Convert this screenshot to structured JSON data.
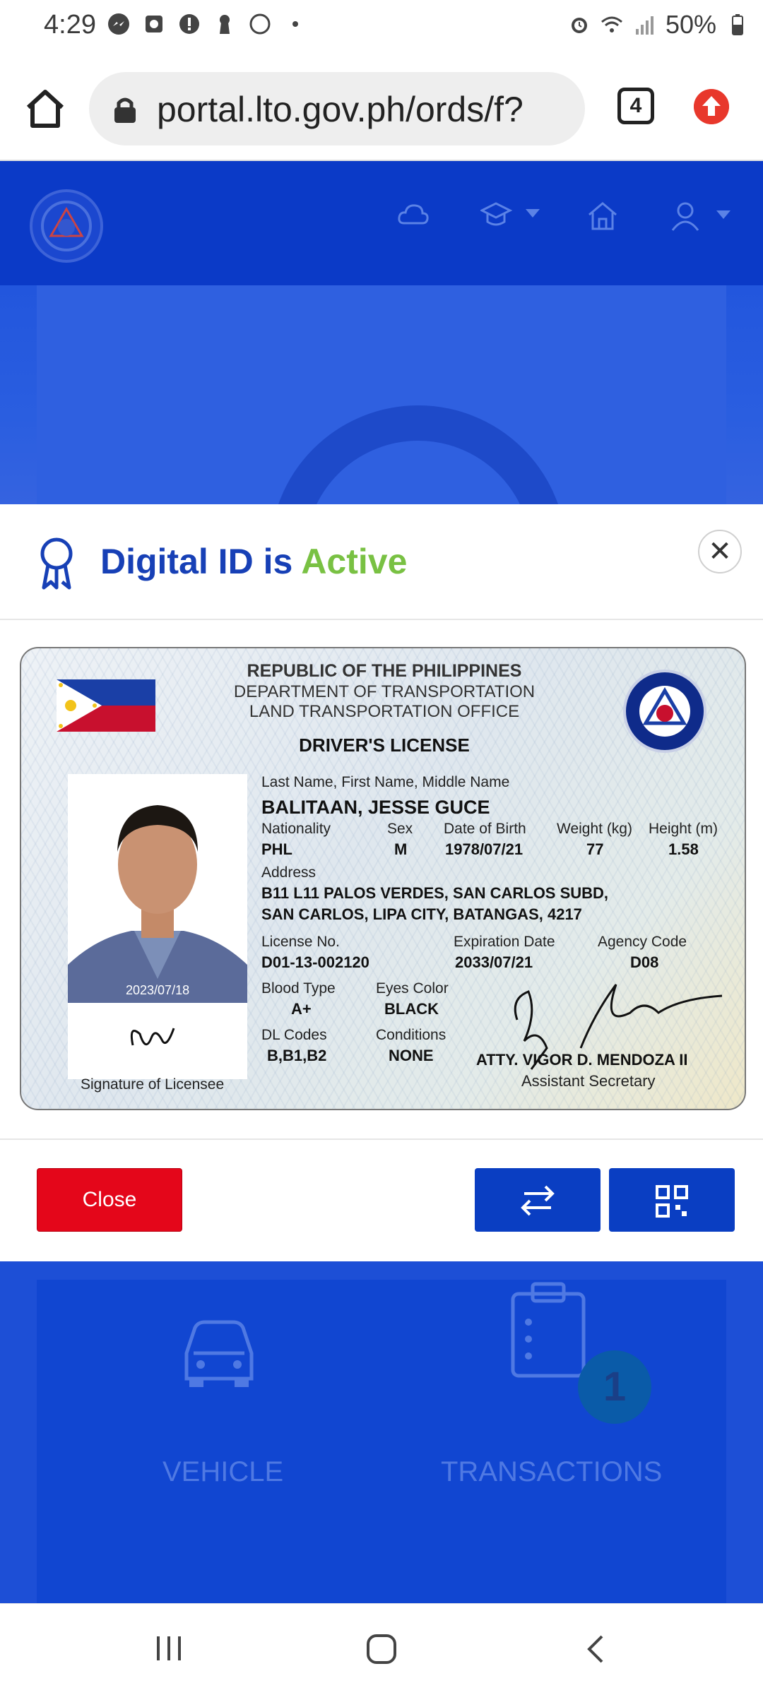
{
  "status_bar": {
    "time": "4:29",
    "battery": "50%"
  },
  "browser": {
    "url": "portal.lto.gov.ph/ords/f?",
    "tab_count": "4"
  },
  "page": {
    "vehicle_label": "VEHICLE",
    "transactions_label": "TRANSACTIONS",
    "transactions_badge": "1"
  },
  "modal": {
    "title_prefix": "Digital ID is",
    "title_status": "Active",
    "close_label": "Close"
  },
  "license": {
    "line1": "REPUBLIC OF THE PHILIPPINES",
    "line2": "DEPARTMENT OF TRANSPORTATION",
    "line3": "LAND TRANSPORTATION OFFICE",
    "card_type": "DRIVER'S LICENSE",
    "name_label": "Last Name, First Name, Middle Name",
    "name": "BALITAAN, JESSE GUCE",
    "nationality_label": "Nationality",
    "nationality": "PHL",
    "sex_label": "Sex",
    "sex": "M",
    "dob_label": "Date of Birth",
    "dob": "1978/07/21",
    "weight_label": "Weight (kg)",
    "weight": "77",
    "height_label": "Height (m)",
    "height": "1.58",
    "address_label": "Address",
    "address_line1": "B11 L11 PALOS VERDES, SAN CARLOS SUBD,",
    "address_line2": "SAN CARLOS, LIPA CITY, BATANGAS, 4217",
    "license_no_label": "License No.",
    "license_no": "D01-13-002120",
    "expiration_label": "Expiration Date",
    "expiration": "2033/07/21",
    "agency_label": "Agency Code",
    "agency": "D08",
    "blood_label": "Blood Type",
    "blood": "A+",
    "eyes_label": "Eyes Color",
    "eyes": "BLACK",
    "dl_codes_label": "DL Codes",
    "dl_codes": "B,B1,B2",
    "conditions_label": "Conditions",
    "conditions": "NONE",
    "photo_date": "2023/07/18",
    "signature_label": "Signature of Licensee",
    "signatory_name": "ATTY. VIGOR D. MENDOZA II",
    "signatory_title": "Assistant Secretary"
  },
  "colors": {
    "brand_blue": "#0b3ac7",
    "active_green": "#79c143",
    "close_red": "#e4061a"
  }
}
